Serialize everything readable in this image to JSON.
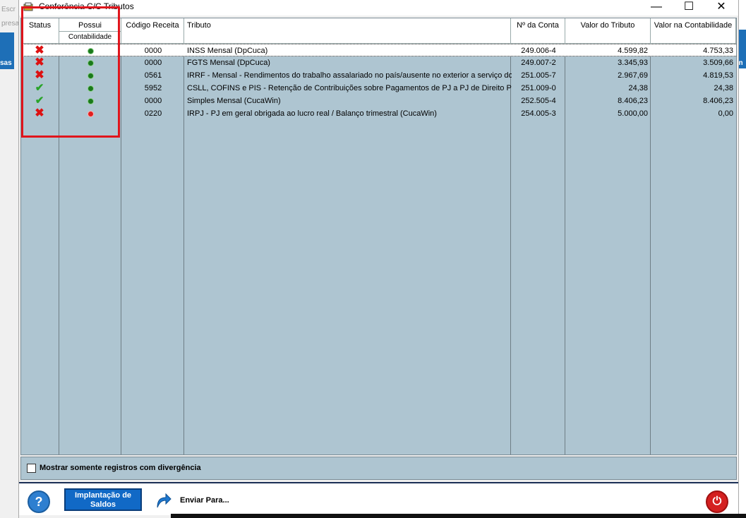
{
  "window": {
    "title": "Conferência C/C Tributos",
    "minimize": "—",
    "maximize": "☐",
    "close": "✕"
  },
  "background": {
    "left_texts": [
      "Escr",
      "presa",
      "sas"
    ],
    "right_text": "an"
  },
  "grid": {
    "columns": {
      "status": "Status",
      "possui": "Possui",
      "possui_sub": "Contabilidade",
      "codigo": "Código Receita",
      "tributo": "Tributo",
      "conta": "Nº da Conta",
      "valor": "Valor do Tributo",
      "contabilidade": "Valor na Contabilidade"
    },
    "rows": [
      {
        "status": "error",
        "status_icon": "x-icon",
        "possui": "green",
        "codigo": "0000",
        "tributo": "INSS Mensal (DpCuca)",
        "conta": "249.006-4",
        "valor": "4.599,82",
        "contabilidade": "4.753,33"
      },
      {
        "status": "error",
        "status_icon": "x-icon",
        "possui": "green",
        "codigo": "0000",
        "tributo": "FGTS Mensal (DpCuca)",
        "conta": "249.007-2",
        "valor": "3.345,93",
        "contabilidade": "3.509,66"
      },
      {
        "status": "error",
        "status_icon": "x-icon",
        "possui": "green",
        "codigo": "0561",
        "tributo": "IRRF - Mensal - Rendimentos do trabalho assalariado no país/ausente no exterior a serviço do p",
        "conta": "251.005-7",
        "valor": "2.967,69",
        "contabilidade": "4.819,53"
      },
      {
        "status": "ok",
        "status_icon": "check-icon",
        "possui": "green",
        "codigo": "5952",
        "tributo": "CSLL, COFINS e PIS - Retenção de Contribuições sobre Pagamentos de PJ a PJ de Direito Privad",
        "conta": "251.009-0",
        "valor": "24,38",
        "contabilidade": "24,38"
      },
      {
        "status": "ok",
        "status_icon": "check-icon",
        "possui": "green",
        "codigo": "0000",
        "tributo": "Simples Mensal (CucaWin)",
        "conta": "252.505-4",
        "valor": "8.406,23",
        "contabilidade": "8.406,23"
      },
      {
        "status": "error",
        "status_icon": "x-icon",
        "possui": "red",
        "codigo": "0220",
        "tributo": "IRPJ - PJ em geral obrigada ao lucro real / Balanço trimestral (CucaWin)",
        "conta": "254.005-3",
        "valor": "5.000,00",
        "contabilidade": "0,00"
      }
    ]
  },
  "filter": {
    "label": "Mostrar somente registros com divergência",
    "checked": false
  },
  "toolbar": {
    "help": "?",
    "implantacao": "Implantação de Saldos",
    "enviar": "Enviar Para...",
    "power": "⏻"
  },
  "colors": {
    "grid_bg": "#aec5d1",
    "highlight": "#e0151c",
    "ok": "#29a329",
    "error": "#d11111",
    "dot_green": "#1a7a1a",
    "dot_red": "#e02020"
  }
}
